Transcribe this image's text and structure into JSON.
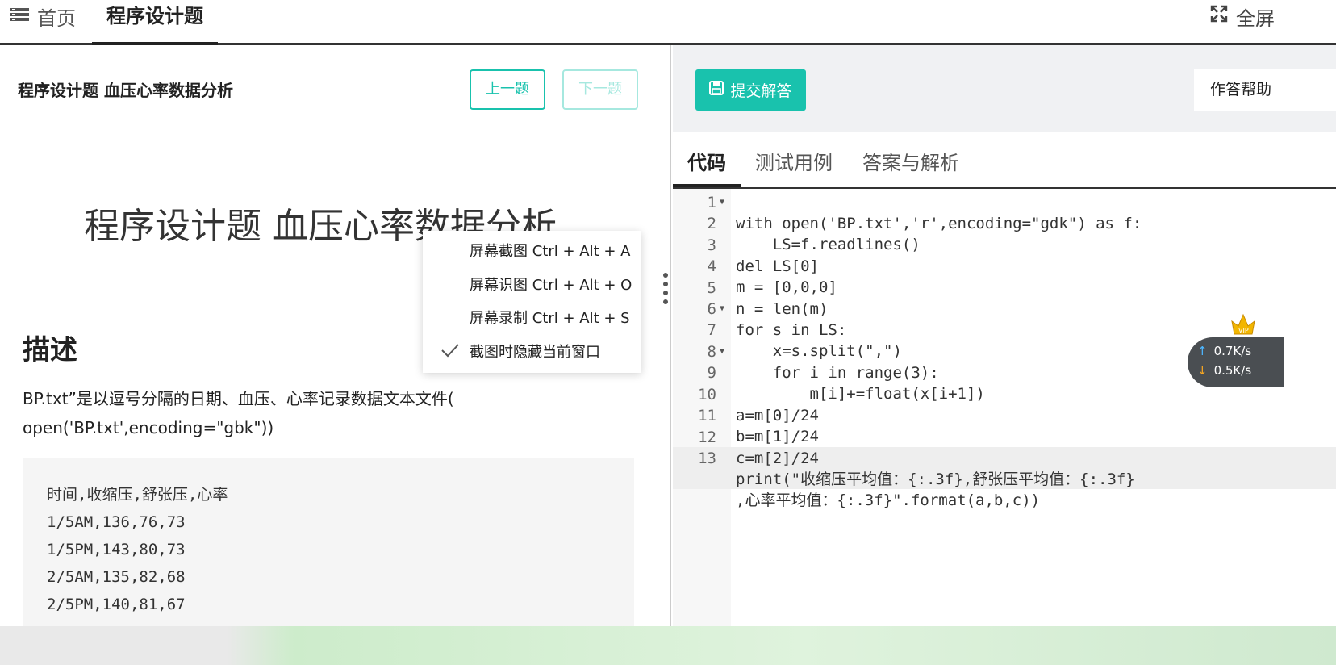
{
  "topbar": {
    "home_label": "首页",
    "active_tab": "程序设计题",
    "fullscreen_label": "全屏"
  },
  "left": {
    "title": "程序设计题 血压心率数据分析",
    "prev_button": "上一题",
    "next_button": "下一题",
    "big_title": "程序设计题 血压心率数据分析",
    "desc_heading": "描述",
    "desc_line1": "BP.txt”是以逗号分隔的日期、血压、心率记录数据文本文件(",
    "desc_line2": "open('BP.txt',encoding=\"gbk\"))",
    "data_lines": [
      "时间,收缩压,舒张压,心率",
      "1/5AM,136,76,73",
      "1/5PM,143,80,73",
      "2/5AM,135,82,68",
      "2/5PM,140,81,67"
    ]
  },
  "context_menu": {
    "items": [
      "屏幕截图 Ctrl + Alt + A",
      "屏幕识图 Ctrl + Alt + O",
      "屏幕录制 Ctrl + Alt + S",
      "截图时隐藏当前窗口"
    ],
    "checked_index": 3
  },
  "right": {
    "submit_button": "提交解答",
    "help_button": "作答帮助",
    "tabs": [
      "代码",
      "测试用例",
      "答案与解析"
    ],
    "line_numbers": [
      "1",
      "2",
      "3",
      "4",
      "5",
      "6",
      "7",
      "8",
      "9",
      "10",
      "11",
      "12",
      "13"
    ]
  },
  "code_lines": [
    "with open('BP.txt','r',encoding=\"gdk\") as f:",
    "    LS=f.readlines()",
    "del LS[0]",
    "m = [0,0,0]",
    "n = len(m)",
    "for s in LS:",
    "    x=s.split(\",\")",
    "    for i in range(3):",
    "        m[i]+=float(x[i+1])",
    "a=m[0]/24",
    "b=m[1]/24",
    "c=m[2]/24",
    "print(\"收缩压平均值：{:.3f},舒张压平均值：{:.3f}",
    ",心率平均值：{:.3f}\".format(a,b,c))"
  ],
  "network_widget": {
    "upload": "0.7K/s",
    "download": "0.5K/s"
  },
  "colors": {
    "accent": "#19c2ad",
    "keyword": "#f06e00",
    "string": "#2c9c2c",
    "number": "#8e4cc4",
    "function": "#d9486d"
  }
}
